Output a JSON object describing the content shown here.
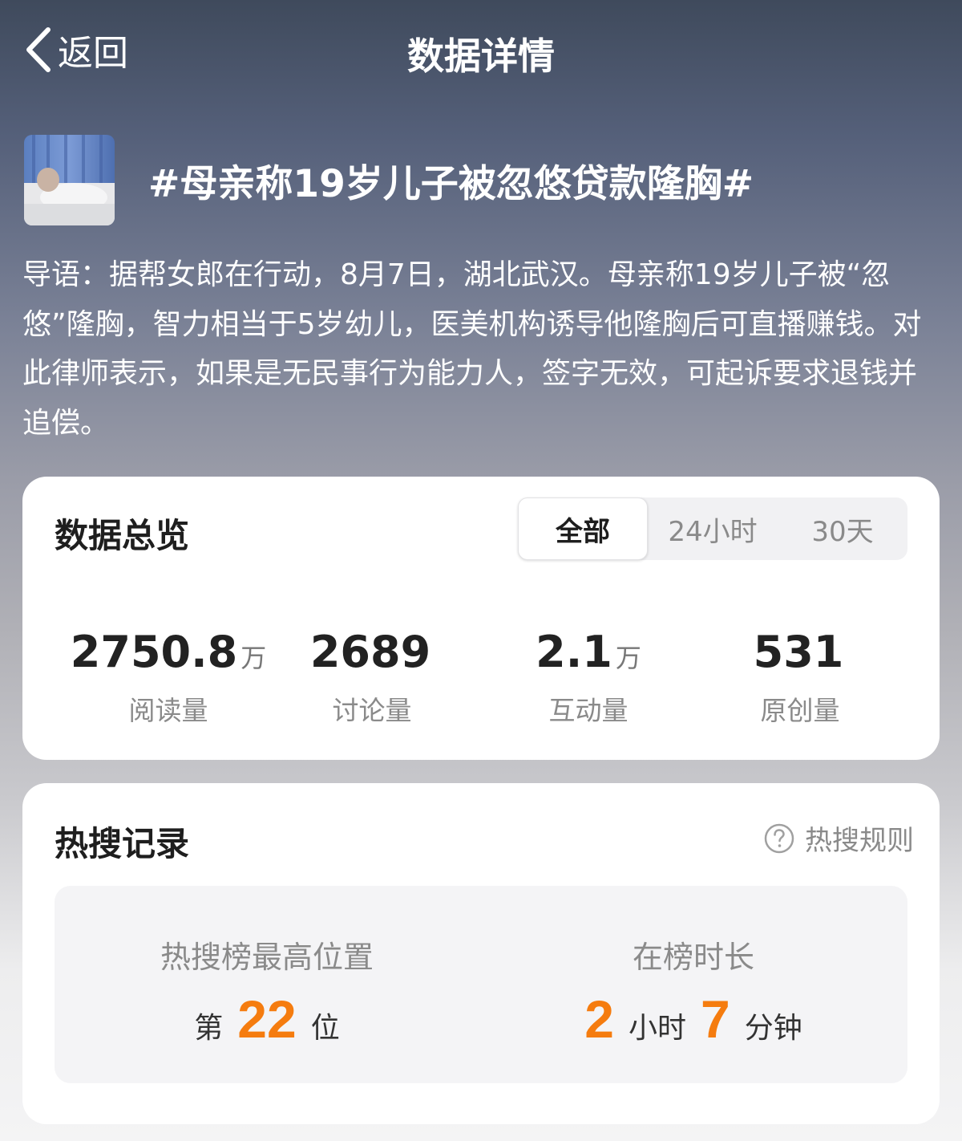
{
  "nav": {
    "back_label": "返回",
    "title": "数据详情"
  },
  "topic": {
    "title": "#母亲称19岁儿子被忽悠贷款隆胸#",
    "intro": "导语：据帮女郎在行动，8月7日，湖北武汉。母亲称19岁儿子被“忽悠”隆胸，智力相当于5岁幼儿，医美机构诱导他隆胸后可直播赚钱。对此律师表示，如果是无民事行为能力人，签字无效，可起诉要求退钱并追偿。"
  },
  "overview": {
    "title": "数据总览",
    "tabs": [
      "全部",
      "24小时",
      "30天"
    ],
    "active_tab": "全部",
    "stats": [
      {
        "value": "2750.8",
        "unit": "万",
        "label": "阅读量"
      },
      {
        "value": "2689",
        "unit": "",
        "label": "讨论量"
      },
      {
        "value": "2.1",
        "unit": "万",
        "label": "互动量"
      },
      {
        "value": "531",
        "unit": "",
        "label": "原创量"
      }
    ]
  },
  "hot_search": {
    "title": "热搜记录",
    "rules_label": "热搜规则",
    "highest": {
      "label": "热搜榜最高位置",
      "prefix": "第",
      "value": "22",
      "suffix": "位"
    },
    "duration": {
      "label": "在榜时长",
      "hours": "2",
      "hours_unit": "小时",
      "minutes": "7",
      "minutes_unit": "分钟"
    }
  },
  "colors": {
    "accent": "#f57c0f",
    "card_bg": "#ffffff",
    "muted_text": "#8a8a8a"
  },
  "icons": {
    "back": "chevron-left-icon",
    "rules": "question-circle-icon",
    "thumbnail": "topic-thumbnail-image"
  }
}
